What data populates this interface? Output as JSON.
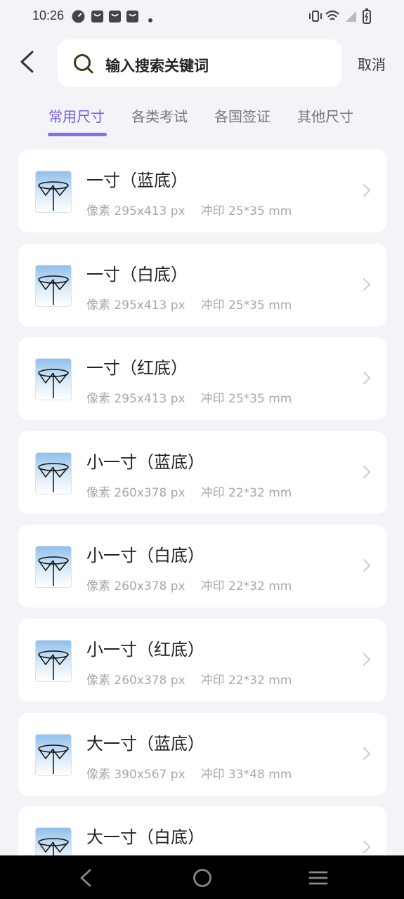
{
  "status_bar": {
    "time": "10:26",
    "left_icons": [
      "speedometer-app-icon",
      "shopping-bag-icon",
      "shopping-bag-icon",
      "shopping-bag-icon",
      "more-dot-icon"
    ],
    "right_icons": [
      "vibrate-icon",
      "wifi-icon",
      "signal-icon",
      "battery-charging-icon"
    ]
  },
  "header": {
    "back_icon": "chevron-left-icon",
    "search_placeholder": "输入搜索关键词",
    "cancel_label": "取消"
  },
  "tabs": [
    {
      "label": "常用尺寸",
      "active": true
    },
    {
      "label": "各类考试",
      "active": false
    },
    {
      "label": "各国签证",
      "active": false
    },
    {
      "label": "其他尺寸",
      "active": false
    }
  ],
  "items": [
    {
      "title": "一寸（蓝底）",
      "pixels": "像素 295x413 px",
      "print": "冲印 25*35 mm"
    },
    {
      "title": "一寸（白底）",
      "pixels": "像素 295x413 px",
      "print": "冲印 25*35 mm"
    },
    {
      "title": "一寸（红底）",
      "pixels": "像素 295x413 px",
      "print": "冲印 25*35 mm"
    },
    {
      "title": "小一寸（蓝底）",
      "pixels": "像素 260x378 px",
      "print": "冲印 22*32 mm"
    },
    {
      "title": "小一寸（白底）",
      "pixels": "像素 260x378 px",
      "print": "冲印 22*32 mm"
    },
    {
      "title": "小一寸（红底）",
      "pixels": "像素 260x378 px",
      "print": "冲印 22*32 mm"
    },
    {
      "title": "大一寸（蓝底）",
      "pixels": "像素 390x567 px",
      "print": "冲印 33*48 mm"
    },
    {
      "title": "大一寸（白底）",
      "pixels": "",
      "print": ""
    }
  ],
  "nav_bar": {
    "icons": [
      "back-triangle-icon",
      "home-circle-icon",
      "menu-lines-icon"
    ]
  },
  "colors": {
    "accent": "#8b6cf0",
    "active_tab_text": "#7b5ce8",
    "background": "#f2f4f7",
    "card": "#ffffff"
  }
}
